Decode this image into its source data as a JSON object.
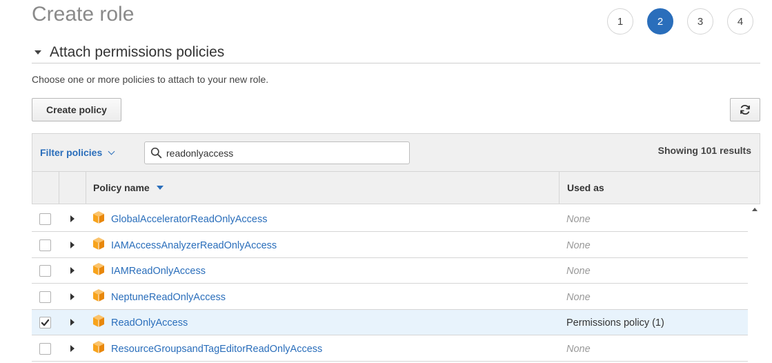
{
  "page": {
    "title": "Create role"
  },
  "steps": [
    "1",
    "2",
    "3",
    "4"
  ],
  "section": {
    "title": "Attach permissions policies"
  },
  "description": "Choose one or more policies to attach to your new role.",
  "toolbar": {
    "create_policy_label": "Create policy",
    "refresh_icon": "refresh-icon"
  },
  "filter": {
    "dropdown_label": "Filter policies",
    "search_value": "readonlyaccess",
    "results_text": "Showing 101 results"
  },
  "table": {
    "columns": {
      "policy_name": "Policy name",
      "used_as": "Used as"
    },
    "rows": [
      {
        "name": "GlobalAcceleratorReadOnlyAccess",
        "used_as": "None",
        "checked": false
      },
      {
        "name": "IAMAccessAnalyzerReadOnlyAccess",
        "used_as": "None",
        "checked": false
      },
      {
        "name": "IAMReadOnlyAccess",
        "used_as": "None",
        "checked": false
      },
      {
        "name": "NeptuneReadOnlyAccess",
        "used_as": "None",
        "checked": false
      },
      {
        "name": "ReadOnlyAccess",
        "used_as": "Permissions policy (1)",
        "checked": true
      },
      {
        "name": "ResourceGroupsandTagEditorReadOnlyAccess",
        "used_as": "None",
        "checked": false
      }
    ]
  },
  "colors": {
    "accent": "#2a6ebb",
    "selected_row": "#e8f3fc",
    "policy_icon": "#f7a31c"
  }
}
